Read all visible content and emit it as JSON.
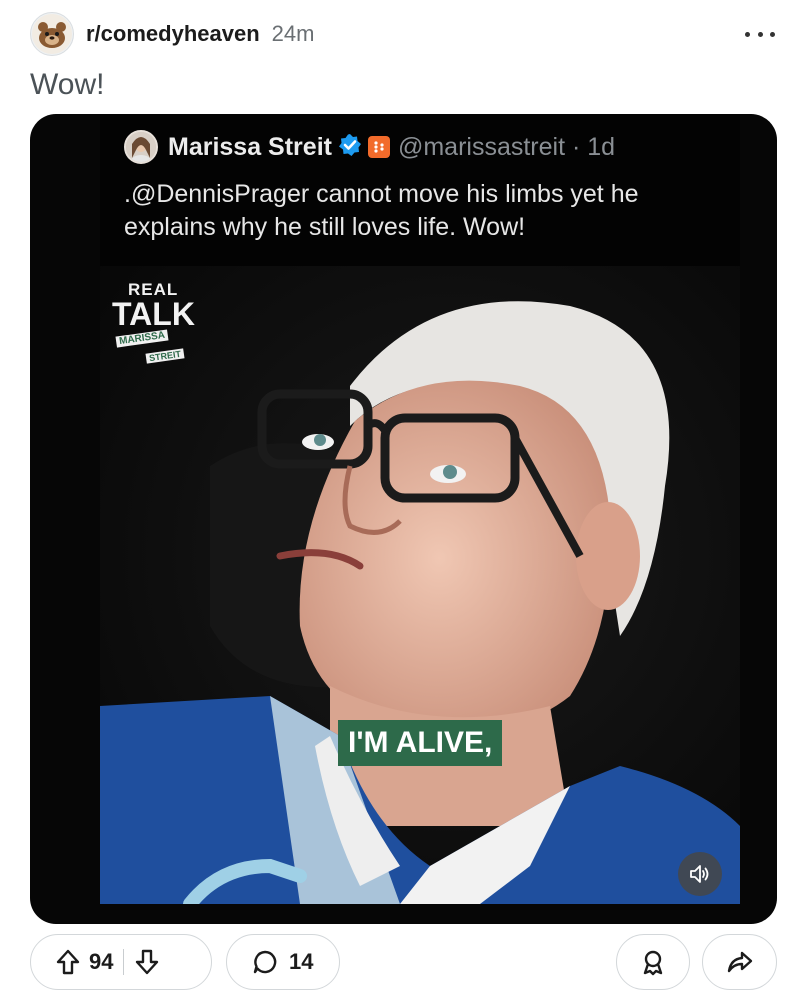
{
  "post": {
    "subreddit": "r/comedyheaven",
    "time_ago": "24m",
    "title": "Wow!",
    "subreddit_avatar_icon": "subreddit-avatar-icon",
    "more_icon": "more-options-icon"
  },
  "tweet": {
    "name": "Marissa Streit",
    "handle": "@marissastreit",
    "age": "· 1d",
    "text": ".@DennisPrager cannot move his limbs yet he explains why he still loves life. Wow!",
    "verified_icon": "verified-badge-icon",
    "org_icon": "org-affiliation-icon"
  },
  "video": {
    "logo_line1": "REAL",
    "logo_line2": "TALK",
    "logo_line3": "MARISSA",
    "logo_line4": "STREIT",
    "caption": "I'M ALIVE,",
    "sound_icon": "volume-icon"
  },
  "actions": {
    "upvotes": "94",
    "comments": "14",
    "upvote_icon": "upvote-arrow-icon",
    "downvote_icon": "downvote-arrow-icon",
    "comment_icon": "comment-bubble-icon",
    "award_icon": "award-icon",
    "share_icon": "share-arrow-icon"
  },
  "colors": {
    "caption_bg": "#2d6a4a",
    "verified_blue": "#1d9bf0",
    "org_orange": "#f26b2b",
    "shirt_blue": "#1f4f9e"
  }
}
